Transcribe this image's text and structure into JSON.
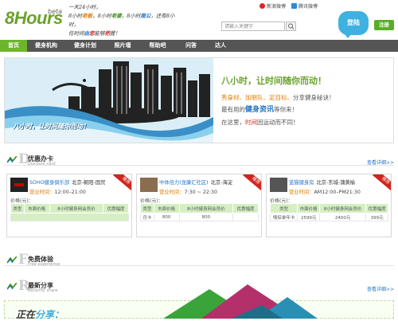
{
  "brand": {
    "logo": "8Hours",
    "beta": "beta"
  },
  "slogan": {
    "l1a": "一天24小时，",
    "l2a": "8小时",
    "l2b": "老板",
    "l2c": "，8小时",
    "l2d": "老婆",
    "l2e": "，8小时",
    "l2f": "周公",
    "l2g": "，还有8小时，",
    "l3a": "任时间",
    "l3b": "由",
    "l3c": "您",
    "l3d": "能够",
    "l3e": "把",
    "l3f": "握",
    "l3g": "！"
  },
  "social": {
    "weibo_sina": "新浪微博",
    "weibo_qq": "腾讯微博"
  },
  "search": {
    "placeholder": "请输入关键字"
  },
  "header": {
    "login": "登陆",
    "register": "注册"
  },
  "nav": {
    "items": [
      "首页",
      "健身机构",
      "健身计划",
      "照片墙",
      "帮助吧",
      "问答",
      "达人"
    ]
  },
  "banner": {
    "caption": "八小时，让时间随你而动！",
    "title": "八小时，让时间随你而动！",
    "l1a": "秀身材、",
    "l1b": "加朋队、",
    "l1c": "定目标、",
    "l1d": "分享健身秘诀！",
    "l2a": "最有用的",
    "l2b": "健身资讯",
    "l2c": "等你来！",
    "l3a": "在这里，",
    "l3b": "时间",
    "l3c": "因运动而不同！"
  },
  "discount": {
    "title": "优惠办卡",
    "subtitle": "Discount card",
    "letter": "D",
    "more": "查看详细>>"
  },
  "cards": [
    {
      "name": "SOHO健身俱乐部",
      "district": "北京-朝阳-国贸",
      "hours_label": "营业时间：",
      "hours": "12:00–21:00",
      "ribbon": "推荐",
      "price_label": "价格(元)：",
      "headers": [
        "类型",
        "市面价格",
        "8小时健身网会员价",
        "优惠幅度"
      ],
      "rows": []
    },
    {
      "name": "中体倍力(龙康汇社区)",
      "district": "北京-海淀",
      "hours_label": "营业时间：",
      "hours": "7:30 ~ 22:30",
      "ribbon": "推荐",
      "price_label": "价格(元)：",
      "headers": [
        "类型",
        "市面价格",
        "8小时健身网会员价",
        "优惠幅度"
      ],
      "rows": [
        [
          "月卡",
          "800",
          "800",
          ""
        ]
      ]
    },
    {
      "name": "蓝猫健身房",
      "district": "北京-东城-蒲黄榆",
      "hours_label": "营业时间：",
      "hours": "AM12:00–PM21:30",
      "ribbon": "推荐",
      "price_label": "价格(元)：",
      "headers": [
        "类型",
        "市面价格",
        "8小时健身网会员价",
        "优惠幅度"
      ],
      "rows": [
        [
          "情侣单年卡",
          "2599元",
          "2400元",
          "399元"
        ]
      ]
    }
  ],
  "free": {
    "title": "免费体验",
    "subtitle": "Free experience",
    "letter": "F"
  },
  "share": {
    "title": "最新分享",
    "subtitle": "Recently share",
    "letter": "R",
    "more": "查看详细>>"
  },
  "share_box": {
    "a": "正在",
    "b": "分享："
  },
  "colors": {
    "green": "#6cb52d",
    "blue": "#1e74c6",
    "orange": "#e37b00",
    "red": "#d0261e",
    "nav": "#555555"
  }
}
